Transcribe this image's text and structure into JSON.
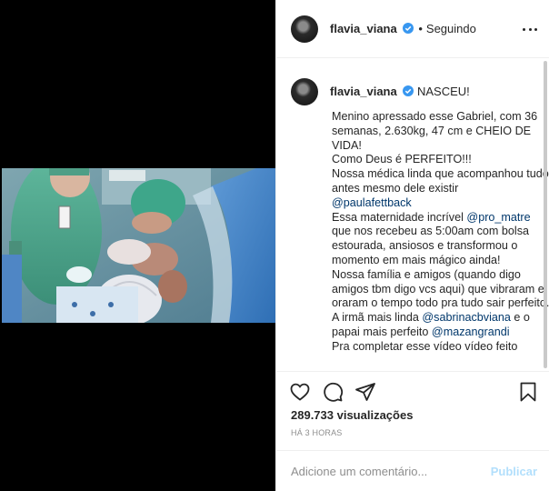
{
  "post": {
    "username": "flavia_viana",
    "follow_status": "Seguindo",
    "dot": "•"
  },
  "caption": {
    "username": "flavia_viana",
    "headline": "NASCEU!",
    "lines": [
      "Menino apressado esse Gabriel, com 36 semanas, 2.630kg, 47 cm e CHEIO DE VIDA!",
      "Como Deus é PERFEITO!!!",
      "Nossa médica linda que acompanhou tudo antes mesmo dele existir"
    ],
    "mention1": "@paulafettback",
    "line_maternity_pre": "Essa maternidade incrível ",
    "mention2": "@pro_matre",
    "line_maternity_post": " que nos recebeu as 5:00am com bolsa estourada, ansiosos e transformou o momento em mais mágico ainda!",
    "line_family": "Nossa família e amigos (quando digo amigos tbm digo vcs aqui) que vibraram e oraram o tempo todo pra tudo sair perfeito.",
    "line_sister_pre": "A irmã mais linda ",
    "mention3": "@sabrinacbviana",
    "line_sister_mid": " e o papai mais perfeito ",
    "mention4": "@mazangrandi",
    "line_last": "Pra completar esse vídeo vídeo feito"
  },
  "stats": {
    "views": "289.733 visualizações",
    "time": "HÁ 3 HORAS"
  },
  "comment_box": {
    "placeholder": "Adicione um comentário...",
    "publish_label": "Publicar"
  },
  "icons": [
    "heart-icon",
    "comment-icon",
    "share-icon",
    "bookmark-icon",
    "more-icon",
    "verified-icon"
  ],
  "colors": {
    "verified": "#3897f0",
    "mention": "#00376b",
    "publish_disabled": "#b2dffc",
    "muted": "#8e8e8e"
  }
}
